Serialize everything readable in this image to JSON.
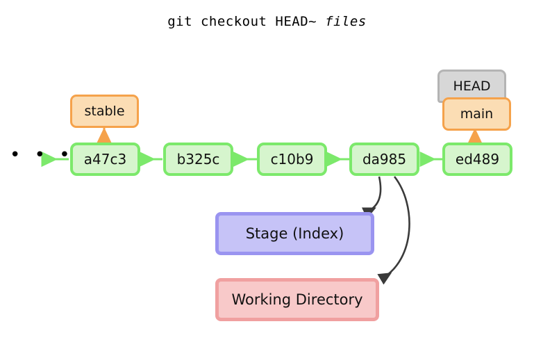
{
  "title": {
    "command": "git checkout HEAD~ ",
    "argument": "files"
  },
  "colors": {
    "commit_fill": "#d6f5cd",
    "commit_border": "#7ce96b",
    "ref_fill": "#fbddb4",
    "ref_border": "#f5a24b",
    "head_fill": "#d7d7d7",
    "head_border": "#b4b4b4",
    "stage_fill": "#c6c3f7",
    "stage_border": "#9a94f0",
    "worktree_fill": "#f8c9c9",
    "worktree_border": "#f0a0a0",
    "arrow_dark": "#3a3a3a",
    "arrow_green": "#7ce96b",
    "arrow_orange": "#f5a24b"
  },
  "ellipsis": "• • •",
  "commits": [
    {
      "id": "a47c3"
    },
    {
      "id": "b325c"
    },
    {
      "id": "c10b9"
    },
    {
      "id": "da985"
    },
    {
      "id": "ed489"
    }
  ],
  "refs": {
    "stable": "stable",
    "branch": "main",
    "head": "HEAD"
  },
  "areas": {
    "stage": "Stage (Index)",
    "working_directory": "Working Directory"
  }
}
